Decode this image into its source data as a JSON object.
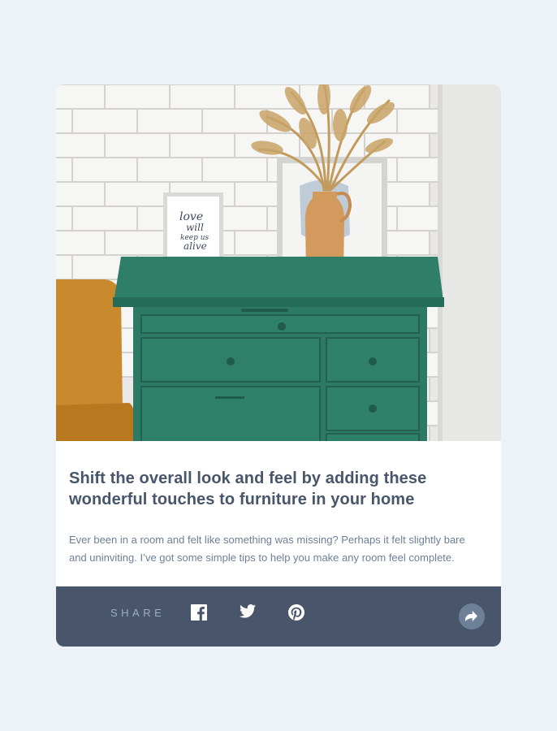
{
  "article": {
    "image_alt": "Green drawer cabinet with picture frames and a vase of dried grass",
    "title": "Shift the overall look and feel by adding these wonderful touches to furniture in your home",
    "excerpt": "Ever been in a room and felt like something was missing? Perhaps it felt slightly bare and uninviting. I’ve got some simple tips to help you make any room feel complete."
  },
  "share": {
    "label": "SHARE",
    "networks": [
      {
        "name": "Facebook",
        "icon": "facebook-icon"
      },
      {
        "name": "Twitter",
        "icon": "twitter-icon"
      },
      {
        "name": "Pinterest",
        "icon": "pinterest-icon"
      }
    ],
    "toggle_icon": "share-arrow-icon"
  },
  "colors": {
    "page_background": "#ECF2F8",
    "card_background": "#FFFFFF",
    "title": "#48556A",
    "body_text": "#6E8098",
    "share_bar": "#48556A",
    "share_label": "#9EAFC2",
    "share_button": "#6E8098",
    "drawer_green": "#2E7E68"
  }
}
